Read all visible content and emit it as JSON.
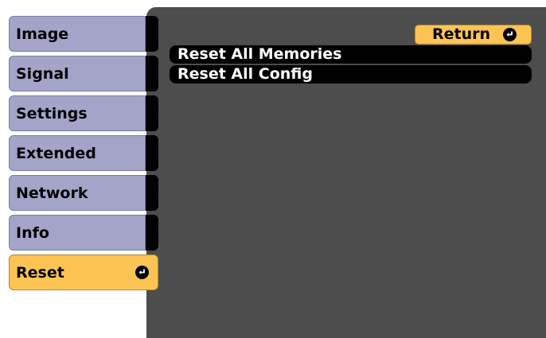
{
  "sidebar": {
    "items": [
      {
        "label": "Image"
      },
      {
        "label": "Signal"
      },
      {
        "label": "Settings"
      },
      {
        "label": "Extended"
      },
      {
        "label": "Network"
      },
      {
        "label": "Info"
      },
      {
        "label": "Reset",
        "active": true
      }
    ]
  },
  "content": {
    "return_label": "Return",
    "menu": [
      {
        "label": "Reset All Memories"
      },
      {
        "label": "Reset All Config"
      }
    ]
  },
  "colors": {
    "panel": "#4d4d4d",
    "tab": "#a4a4c9",
    "active": "#fcc453",
    "row": "#000000"
  },
  "icons": {
    "enter": "enter-icon"
  }
}
